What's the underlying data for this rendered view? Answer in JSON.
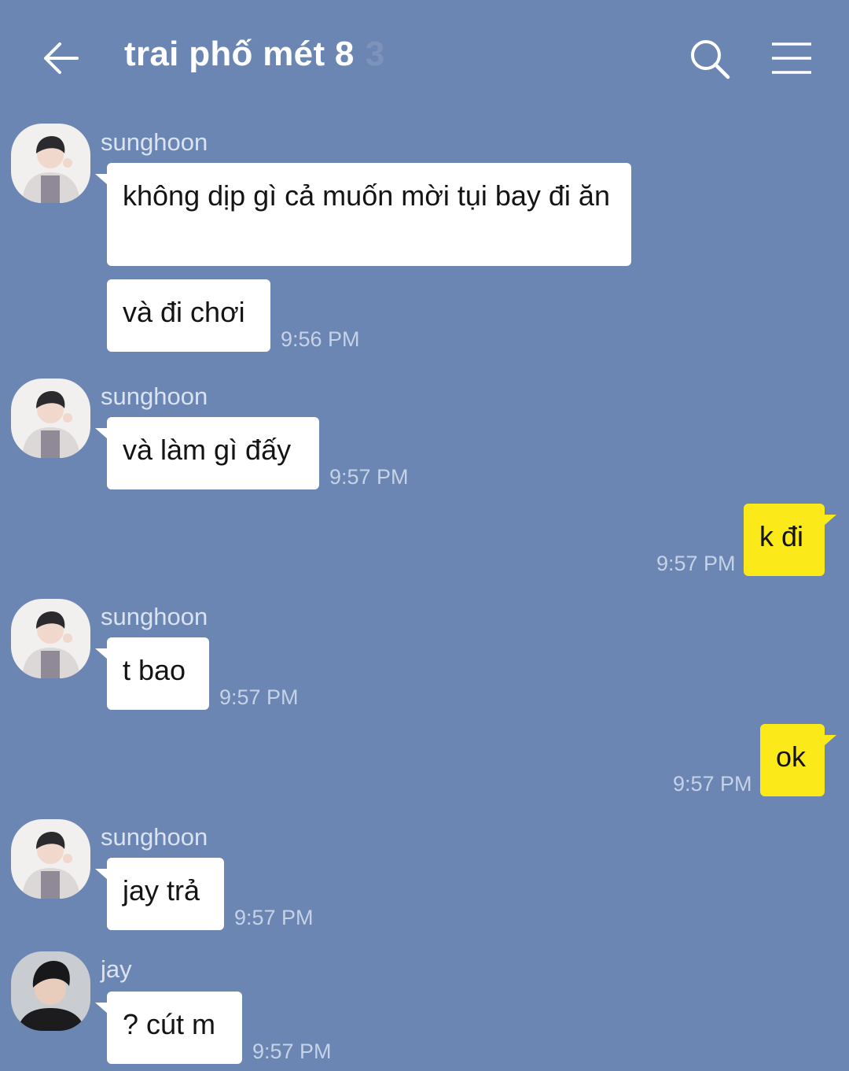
{
  "header": {
    "title": "trai phố mét 8",
    "member_count": "3"
  },
  "messages": [
    {
      "sender": "sunghoon",
      "text": "không dịp gì cả muốn mời tụi bay đi ăn",
      "time": ""
    },
    {
      "sender": "",
      "text": "và đi chơi",
      "time": "9:56 PM"
    },
    {
      "sender": "sunghoon",
      "text": "và làm gì đấy",
      "time": "9:57 PM"
    },
    {
      "sender": "",
      "text": "k đi",
      "time": "9:57 PM",
      "own": true
    },
    {
      "sender": "sunghoon",
      "text": "t bao",
      "time": "9:57 PM"
    },
    {
      "sender": "",
      "text": "ok",
      "time": "9:57 PM",
      "own": true
    },
    {
      "sender": "sunghoon",
      "text": "jay trả",
      "time": "9:57 PM"
    },
    {
      "sender": "jay",
      "text": "? cút m",
      "time": "9:57 PM"
    }
  ],
  "colors": {
    "background": "#6b86b3",
    "own_bubble": "#fce91a",
    "other_bubble": "#ffffff"
  },
  "icons": [
    "back-arrow-icon",
    "search-icon",
    "menu-icon",
    "user-avatar-icon"
  ]
}
